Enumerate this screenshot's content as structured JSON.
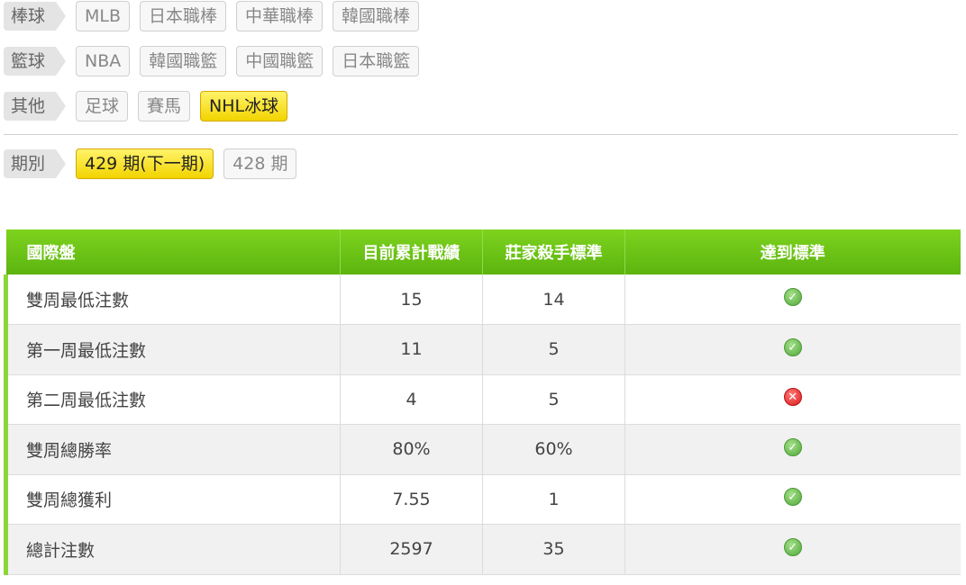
{
  "filters": [
    {
      "label": "棒球",
      "chips": [
        {
          "text": "MLB",
          "active": false
        },
        {
          "text": "日本職棒",
          "active": false
        },
        {
          "text": "中華職棒",
          "active": false
        },
        {
          "text": "韓國職棒",
          "active": false
        }
      ]
    },
    {
      "label": "籃球",
      "chips": [
        {
          "text": "NBA",
          "active": false
        },
        {
          "text": "韓國職籃",
          "active": false
        },
        {
          "text": "中國職籃",
          "active": false
        },
        {
          "text": "日本職籃",
          "active": false
        }
      ]
    },
    {
      "label": "其他",
      "chips": [
        {
          "text": "足球",
          "active": false
        },
        {
          "text": "賽馬",
          "active": false
        },
        {
          "text": "NHL冰球",
          "active": true
        }
      ]
    }
  ],
  "period": {
    "label": "期別",
    "chips": [
      {
        "text": "429 期(下一期)",
        "active": true
      },
      {
        "text": "428 期",
        "active": false
      }
    ]
  },
  "table": {
    "headers": [
      "國際盤",
      "目前累計戰績",
      "莊家殺手標準",
      "達到標準"
    ],
    "rows": [
      {
        "name": "雙周最低注數",
        "current": "15",
        "standard": "14",
        "met": true
      },
      {
        "name": "第一周最低注數",
        "current": "11",
        "standard": "5",
        "met": true
      },
      {
        "name": "第二周最低注數",
        "current": "4",
        "standard": "5",
        "met": false
      },
      {
        "name": "雙周總勝率",
        "current": "80%",
        "standard": "60%",
        "met": true
      },
      {
        "name": "雙周總獲利",
        "current": "7.55",
        "standard": "1",
        "met": true
      },
      {
        "name": "總計注數",
        "current": "2597",
        "standard": "35",
        "met": true
      }
    ]
  },
  "icons": {
    "met": "check-circle-icon",
    "not_met": "x-circle-icon"
  },
  "colors": {
    "header_green": "#6cc416",
    "active_chip": "#f7e21a",
    "fail_red": "#d91a1a",
    "ok_green": "#4fa83a"
  }
}
